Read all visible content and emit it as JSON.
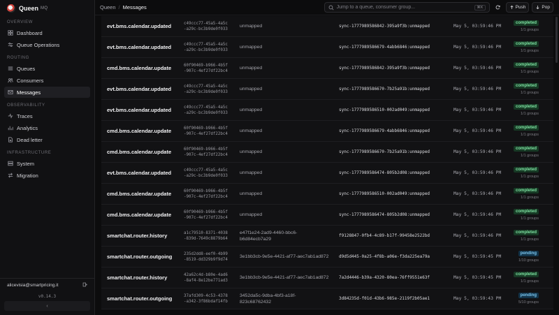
{
  "brand": {
    "name": "Queen",
    "sub": "MQ"
  },
  "sidebar": {
    "sections": [
      {
        "label": "OVERVIEW",
        "items": [
          {
            "label": "Dashboard",
            "icon": "grid-icon"
          },
          {
            "label": "Queue Operations",
            "icon": "sliders-icon"
          }
        ]
      },
      {
        "label": "ROUTING",
        "items": [
          {
            "label": "Queues",
            "icon": "list-icon"
          },
          {
            "label": "Consumers",
            "icon": "users-icon"
          },
          {
            "label": "Messages",
            "icon": "mail-icon",
            "active": true
          }
        ]
      },
      {
        "label": "OBSERVABILITY",
        "items": [
          {
            "label": "Traces",
            "icon": "trace-icon"
          },
          {
            "label": "Analytics",
            "icon": "chart-icon"
          },
          {
            "label": "Dead letter",
            "icon": "file-icon"
          }
        ]
      },
      {
        "label": "INFRASTRUCTURE",
        "items": [
          {
            "label": "System",
            "icon": "server-icon"
          },
          {
            "label": "Migration",
            "icon": "migration-icon"
          }
        ]
      }
    ],
    "user": "alicevisia@smartpricing.it",
    "version": "v0.14.3",
    "collapse": "‹"
  },
  "topbar": {
    "breadcrumb_root": "Queen",
    "breadcrumb_current": "Messages",
    "search_placeholder": "Jump to a queue, consumer group...",
    "search_kbd": "⌘K",
    "push_label": "Push",
    "pop_label": "Pop"
  },
  "messages": [
    {
      "name": "evt.bms.calendar.updated",
      "id1": "c49ccc77-45a5-4a5c",
      "id2": "-a29c-bc3b9de0f033",
      "consumer1": "unmapped",
      "consumer2": "",
      "trace": "sync-1777989586842-395a9f3b:unmapped",
      "time": "May 5, 03:59:46 PM",
      "status": "completed",
      "groups": "1/1 groups"
    },
    {
      "name": "evt.bms.calendar.updated",
      "id1": "c49ccc77-45a5-4a5c",
      "id2": "-a29c-bc3b9de0f033",
      "consumer1": "unmapped",
      "consumer2": "",
      "trace": "sync-1777989586679-4abb6846:unmapped",
      "time": "May 5, 03:59:46 PM",
      "status": "completed",
      "groups": "1/1 groups"
    },
    {
      "name": "cmd.bms.calendar.update",
      "id1": "60f90469-b966-4b5f",
      "id2": "-907c-4ef27df22bc4",
      "consumer1": "unmapped",
      "consumer2": "",
      "trace": "sync-1777989586842-395a9f3b:unmapped",
      "time": "May 5, 03:59:46 PM",
      "status": "completed",
      "groups": "1/1 groups"
    },
    {
      "name": "evt.bms.calendar.updated",
      "id1": "c49ccc77-45a5-4a5c",
      "id2": "-a29c-bc3b9de0f033",
      "consumer1": "unmapped",
      "consumer2": "",
      "trace": "sync-1777989586670-7b25a91b:unmapped",
      "time": "May 5, 03:59:46 PM",
      "status": "completed",
      "groups": "1/1 groups"
    },
    {
      "name": "evt.bms.calendar.updated",
      "id1": "c49ccc77-45a5-4a5c",
      "id2": "-a29c-bc3b9de0f033",
      "consumer1": "unmapped",
      "consumer2": "",
      "trace": "sync-1777989586510-002ad049:unmapped",
      "time": "May 5, 03:59:46 PM",
      "status": "completed",
      "groups": "1/1 groups"
    },
    {
      "name": "cmd.bms.calendar.update",
      "id1": "60f90469-b966-4b5f",
      "id2": "-907c-4ef27df22bc4",
      "consumer1": "unmapped",
      "consumer2": "",
      "trace": "sync-1777989586679-4abb6846:unmapped",
      "time": "May 5, 03:59:46 PM",
      "status": "completed",
      "groups": "1/1 groups"
    },
    {
      "name": "cmd.bms.calendar.update",
      "id1": "60f90469-b966-4b5f",
      "id2": "-907c-4ef27df22bc4",
      "consumer1": "unmapped",
      "consumer2": "",
      "trace": "sync-1777989586670-7b25a91b:unmapped",
      "time": "May 5, 03:59:46 PM",
      "status": "completed",
      "groups": "1/1 groups"
    },
    {
      "name": "evt.bms.calendar.updated",
      "id1": "c49ccc77-45a5-4a5c",
      "id2": "-a29c-bc3b9de0f033",
      "consumer1": "unmapped",
      "consumer2": "",
      "trace": "sync-1777989586474-805b2d08:unmapped",
      "time": "May 5, 03:59:46 PM",
      "status": "completed",
      "groups": "1/1 groups"
    },
    {
      "name": "cmd.bms.calendar.update",
      "id1": "60f90469-b966-4b5f",
      "id2": "-907c-4ef27df22bc4",
      "consumer1": "unmapped",
      "consumer2": "",
      "trace": "sync-1777989586510-002ad049:unmapped",
      "time": "May 5, 03:59:46 PM",
      "status": "completed",
      "groups": "1/1 groups"
    },
    {
      "name": "cmd.bms.calendar.update",
      "id1": "60f90469-b966-4b5f",
      "id2": "-907c-4ef27df22bc4",
      "consumer1": "unmapped",
      "consumer2": "",
      "trace": "sync-1777989586474-805b2d08:unmapped",
      "time": "May 5, 03:59:46 PM",
      "status": "completed",
      "groups": "1/1 groups"
    },
    {
      "name": "smartchat.router.history",
      "id1": "a1c79510-8371-4038",
      "id2": "-839d-7649c8879b64",
      "consumer1": "e47f1e24-2ad9-4460-bbc6-",
      "consumer2": "b6d84ecb7a29",
      "trace": "f9128847-0fb4-4c89-b17f-99458e2522bd",
      "time": "May 5, 03:59:46 PM",
      "status": "completed",
      "groups": "1/1 groups"
    },
    {
      "name": "smartchat.router.outgoing",
      "id1": "235d2dd8-eef0-4b99",
      "id2": "-8519-dd329b9f9d74",
      "consumer1": "3e1bb3cb-9e5e-4421-af77-aec7ab1ad872",
      "consumer2": "",
      "trace": "d9d5d445-0a25-4f8b-a06e-f3da225ea79a",
      "time": "May 5, 03:59:45 PM",
      "status": "pending",
      "groups": "1/10 groups"
    },
    {
      "name": "smartchat.router.history",
      "id1": "42a62c4d-b80e-4ad6",
      "id2": "-8af4-8e12be771ad3",
      "consumer1": "3e1bb3cb-9e5e-4421-af77-aec7ab1ad872",
      "consumer2": "",
      "trace": "7a2d4446-b39a-4320-80ea-76ff9551e63f",
      "time": "May 5, 03:59:45 PM",
      "status": "completed",
      "groups": "1/1 groups"
    },
    {
      "name": "smartchat.router.outgoing",
      "id1": "37afd309-4c53-4378",
      "id2": "-a342-3f86bdaf14fb",
      "consumer1": "3452da5c-9dba-4bf3-a18f-",
      "consumer2": "823c68762432",
      "trace": "3d84235d-f01d-43b6-985e-2119f2b05ae1",
      "time": "May 5, 03:59:43 PM",
      "status": "pending",
      "groups": "5/10 groups"
    }
  ]
}
